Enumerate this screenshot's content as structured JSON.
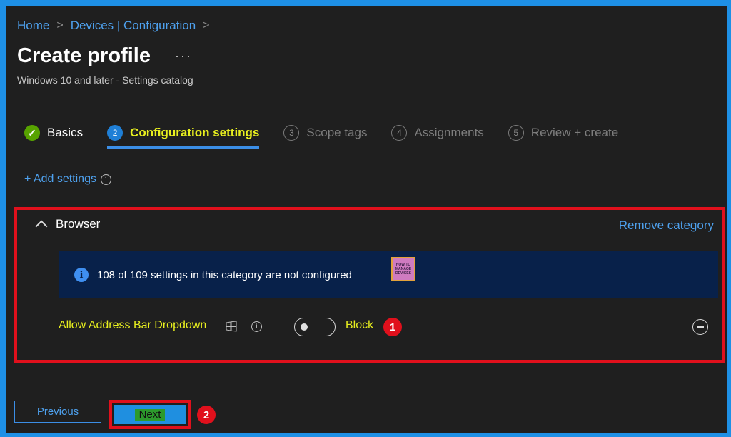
{
  "breadcrumb": {
    "home": "Home",
    "separator": ">",
    "section": "Devices | Configuration"
  },
  "page": {
    "title": "Create profile",
    "more": "···",
    "subtitle": "Windows 10 and later - Settings catalog"
  },
  "steps": [
    {
      "number": "✓",
      "label": "Basics",
      "state": "done"
    },
    {
      "number": "2",
      "label": "Configuration settings",
      "state": "active"
    },
    {
      "number": "3",
      "label": "Scope tags",
      "state": "pending"
    },
    {
      "number": "4",
      "label": "Assignments",
      "state": "pending"
    },
    {
      "number": "5",
      "label": "Review + create",
      "state": "pending"
    }
  ],
  "add_settings": {
    "label": "+ Add settings",
    "info": "i"
  },
  "category": {
    "name": "Browser",
    "remove_label": "Remove category",
    "banner_text": "108 of 109 settings in this category are not configured",
    "banner_icon": "i",
    "logo_text": [
      "HOW TO",
      "MANAGE",
      "DEVICES"
    ]
  },
  "setting": {
    "label": "Allow Address Bar Dropdown",
    "info": "i",
    "toggle_state": "Block",
    "toggle_on": false,
    "badge": "1"
  },
  "footer": {
    "previous_label": "Previous",
    "next_label": "Next",
    "badge": "2"
  },
  "colors": {
    "accent": "#1e90e6",
    "highlight_red": "#e0101c",
    "highlight_yellow": "#e8ef1f",
    "success": "#57a300"
  }
}
